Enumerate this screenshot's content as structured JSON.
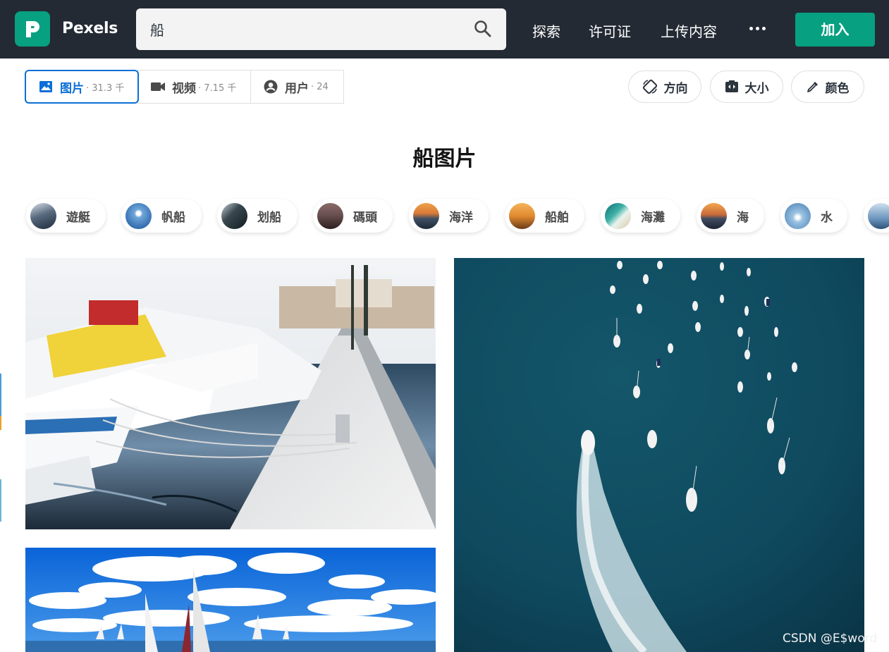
{
  "header": {
    "brand": "Pexels",
    "search_value": "船",
    "nav": [
      "探索",
      "许可证",
      "上传内容"
    ],
    "join_label": "加入"
  },
  "tabs": [
    {
      "label": "图片",
      "count": "· 31.3 千",
      "icon": "image-icon",
      "active": true
    },
    {
      "label": "视频",
      "count": "· 7.15 千",
      "icon": "video-camera-icon",
      "active": false
    },
    {
      "label": "用户",
      "count": "· 24",
      "icon": "user-circle-icon",
      "active": false
    }
  ],
  "filters": [
    {
      "label": "方向",
      "icon": "orientation-icon"
    },
    {
      "label": "大小",
      "icon": "size-icon"
    },
    {
      "label": "颜色",
      "icon": "eyedropper-icon"
    }
  ],
  "page_title": "船图片",
  "related_chips": [
    "遊艇",
    "帆船",
    "划船",
    "碼頭",
    "海洋",
    "船舶",
    "海灘",
    "海",
    "水"
  ],
  "watermark": "CSDN @E$word",
  "colors": {
    "topbar": "#232a34",
    "brand_green": "#07a081",
    "active_tab": "#0b6fd6"
  }
}
